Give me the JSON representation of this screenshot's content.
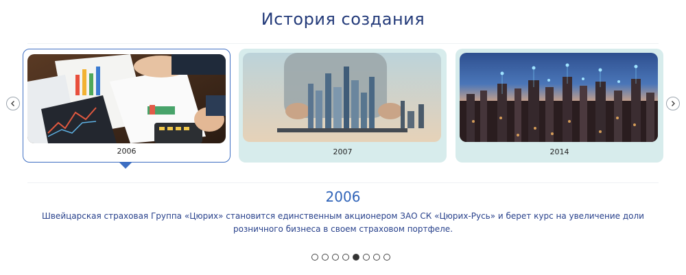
{
  "section": {
    "title": "История создания"
  },
  "carousel": {
    "cards": [
      {
        "year": "2006",
        "image": "business-charts-documents-photo"
      },
      {
        "year": "2007",
        "image": "city-on-tablet-photo"
      },
      {
        "year": "2014",
        "image": "city-night-network-photo"
      }
    ],
    "active_index": 0,
    "prev_icon": "chevron-left-icon",
    "next_icon": "chevron-right-icon"
  },
  "detail": {
    "year": "2006",
    "text": "Швейцарская страховая Группа «Цюрих» становится единственным акционером ЗАО СК «Цюрих-Русь» и берет курс на увеличение доли розничного бизнеса в своем страховом портфеле."
  },
  "pagination": {
    "total": 8,
    "active": 4
  },
  "colors": {
    "title": "#243b7a",
    "accent": "#3d6ec2",
    "card_bg": "#d7ecec",
    "text": "#27408b"
  }
}
